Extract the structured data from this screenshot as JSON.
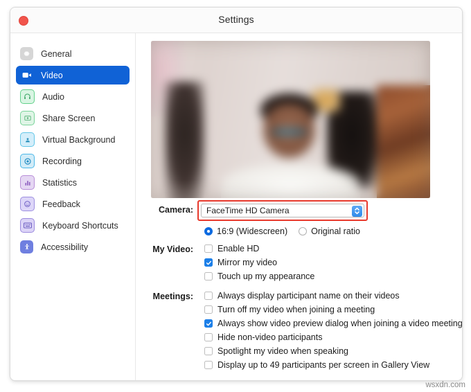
{
  "window": {
    "title": "Settings",
    "close_button": "close"
  },
  "sidebar": {
    "items": [
      {
        "label": "General",
        "icon": "gear-icon",
        "color": "#d6d6d6",
        "selected": false
      },
      {
        "label": "Video",
        "icon": "video-camera-icon",
        "color": "#1062d6",
        "selected": true
      },
      {
        "label": "Audio",
        "icon": "headphones-icon",
        "color": "#63d18b",
        "selected": false
      },
      {
        "label": "Share Screen",
        "icon": "share-screen-icon",
        "color": "#7ad39a",
        "selected": false
      },
      {
        "label": "Virtual Background",
        "icon": "person-frame-icon",
        "color": "#62c6e8",
        "selected": false
      },
      {
        "label": "Recording",
        "icon": "record-circle-icon",
        "color": "#4cb8e8",
        "selected": false
      },
      {
        "label": "Statistics",
        "icon": "bar-chart-icon",
        "color": "#b98fd8",
        "selected": false
      },
      {
        "label": "Feedback",
        "icon": "smiley-face-icon",
        "color": "#9d8fe0",
        "selected": false
      },
      {
        "label": "Keyboard Shortcuts",
        "icon": "keyboard-icon",
        "color": "#9b8ade",
        "selected": false
      },
      {
        "label": "Accessibility",
        "icon": "accessibility-icon",
        "color": "#6f7fe0",
        "selected": false
      }
    ]
  },
  "video_panel": {
    "preview_alt": "camera-preview",
    "camera": {
      "label": "Camera:",
      "selected_value": "FaceTime HD Camera",
      "highlight_color": "#e8392c",
      "stepper_color": "#2f8bea"
    },
    "aspect_ratio": {
      "options": [
        {
          "label": "16:9 (Widescreen)",
          "selected": true
        },
        {
          "label": "Original ratio",
          "selected": false
        }
      ]
    },
    "my_video": {
      "label": "My Video:",
      "options": [
        {
          "label": "Enable HD",
          "checked": false
        },
        {
          "label": "Mirror my video",
          "checked": true
        },
        {
          "label": "Touch up my appearance",
          "checked": false
        }
      ]
    },
    "meetings": {
      "label": "Meetings:",
      "options": [
        {
          "label": "Always display participant name on their videos",
          "checked": false
        },
        {
          "label": "Turn off my video when joining a meeting",
          "checked": false
        },
        {
          "label": "Always show video preview dialog when joining a video meeting",
          "checked": true
        },
        {
          "label": "Hide non-video participants",
          "checked": false
        },
        {
          "label": "Spotlight my video when speaking",
          "checked": false
        },
        {
          "label": "Display up to 49 participants per screen in Gallery View",
          "checked": false
        }
      ]
    }
  },
  "watermark": {
    "text": "wsxdn.com"
  }
}
